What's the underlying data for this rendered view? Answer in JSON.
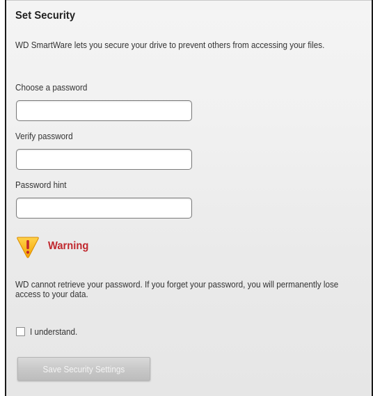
{
  "title": "Set Security",
  "intro": "WD SmartWare lets you secure your drive to prevent others from accessing your files.",
  "fields": {
    "password": {
      "label": "Choose a password",
      "value": ""
    },
    "verify": {
      "label": "Verify password",
      "value": ""
    },
    "hint": {
      "label": "Password hint",
      "value": ""
    }
  },
  "warning": {
    "icon": "warning-triangle-icon",
    "title": "Warning",
    "text": "WD cannot retrieve your password. If you forget your password, you will permanently lose access to your data.",
    "color": "#c0272d"
  },
  "understand": {
    "label": "I understand.",
    "checked": false
  },
  "save_button": "Save Security Settings"
}
